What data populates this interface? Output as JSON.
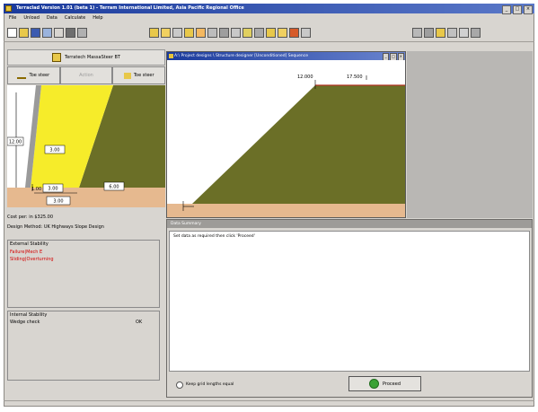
{
  "app": {
    "title": "Terraclad Version 1.01 (beta 1) - Terram International Limited, Asia Pacific Regional Office"
  },
  "menu": [
    "File",
    "Unload",
    "Data",
    "Calculate",
    "Help"
  ],
  "left_panel": {
    "top_button_label": "Terratech MassaSteer BT",
    "tabs": [
      {
        "label": "Toe steer",
        "enabled": true
      },
      {
        "label": "Action",
        "enabled": false
      },
      {
        "label": "Toe steer",
        "enabled": true
      }
    ],
    "dims": {
      "height": "12.00",
      "left_top": "3.00",
      "mid": "3.00",
      "bottom_left": "1.00",
      "bottom_right": "3.00",
      "right": "6.00"
    },
    "info_line1": "Cost per: in $325.00",
    "info_line2": "Design Method: UK Highways Slope Design",
    "external_stability": {
      "title": "External Stability",
      "lines": [
        "Failure|Mech E",
        "Sliding|Overturning"
      ]
    },
    "internal_stability": {
      "title": "Internal Stability",
      "rows": [
        {
          "label": "Wedge check",
          "value": "OK"
        }
      ]
    }
  },
  "drawing_window": {
    "title": "A:\\ Project designs \\ Structure designer [Unconditioned] Sequence",
    "dim_left": "12.000",
    "dim_right": "17.500"
  },
  "message_window": {
    "title": "Data Summary",
    "text": "Set data as required then click 'Proceed'",
    "keep_grid_label": "Keep grid lengths equal",
    "proceed_label": "Proceed"
  },
  "colors": {
    "soil": "#6b6f27",
    "fill": "#f6ec2a",
    "ground": "#e6b98f",
    "title_bar": "#1a3a9c"
  }
}
